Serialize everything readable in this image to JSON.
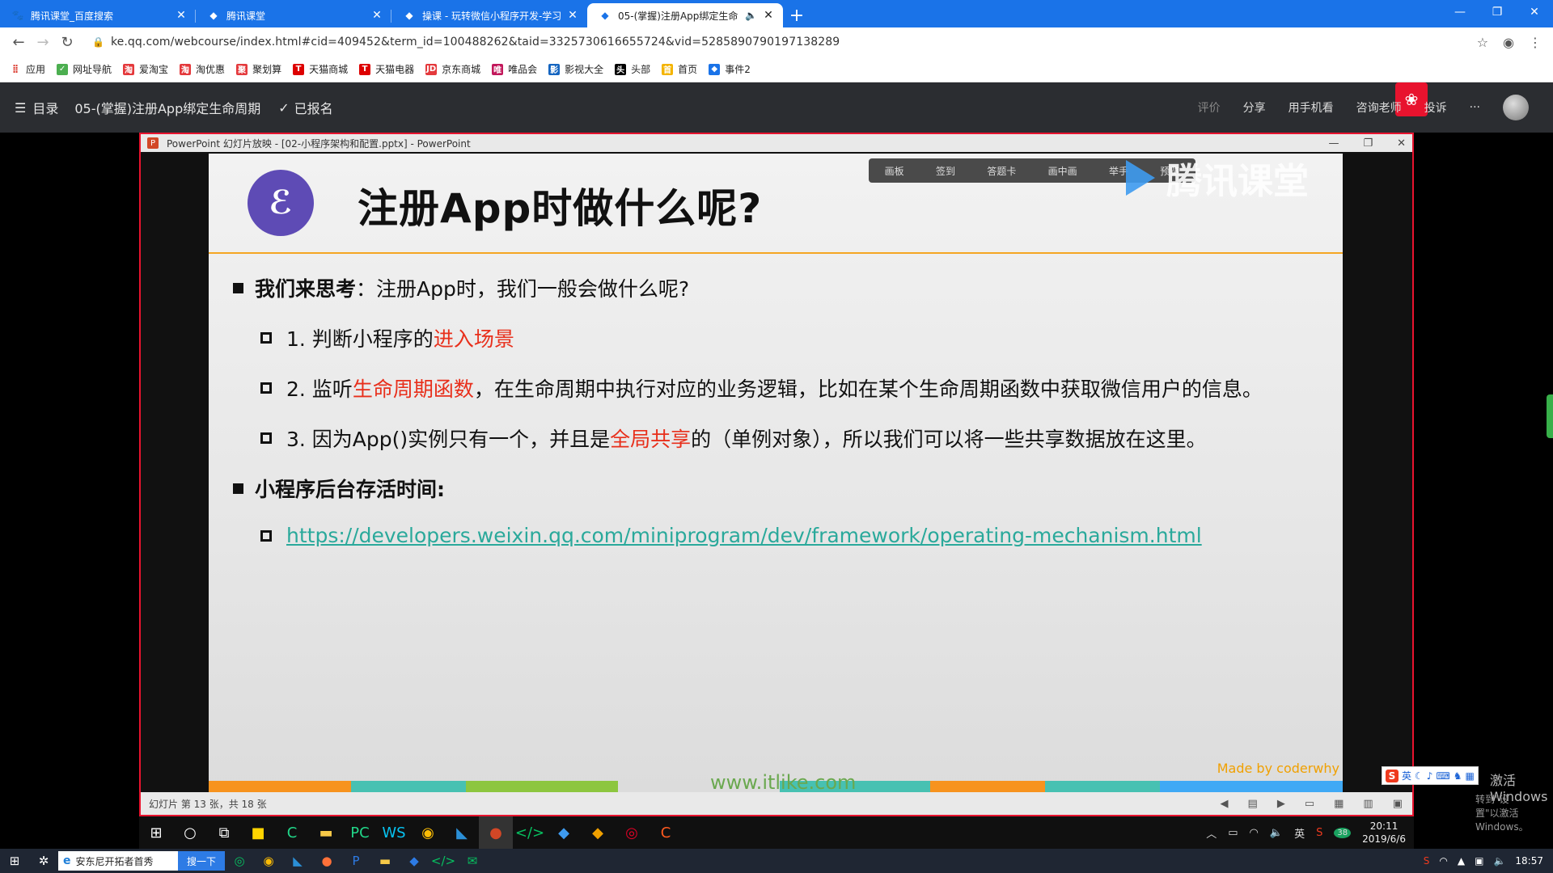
{
  "browser": {
    "tabs": [
      {
        "title": "腾讯课堂_百度搜索",
        "icon": "baidu-icon",
        "active": false
      },
      {
        "title": "腾讯课堂",
        "icon": "tencent-classroom-icon",
        "active": false
      },
      {
        "title": "操课 - 玩转微信小程序开发-学习",
        "icon": "tencent-classroom-icon",
        "active": false
      },
      {
        "title": "05-(掌握)注册App绑定生命",
        "icon": "tencent-classroom-icon",
        "active": true
      }
    ],
    "new_tab": "+",
    "url": "ke.qq.com/webcourse/index.html#cid=409452&term_id=100488262&taid=3325730616655724&vid=5285890790197138289",
    "bookmarks": [
      "应用",
      "网址导航",
      "爱淘宝",
      "淘优惠",
      "聚划算",
      "天猫商城",
      "天猫电器",
      "京东商城",
      "唯品会",
      "影视大全",
      "头部",
      "首页",
      "事件2"
    ]
  },
  "course_header": {
    "menu_label": "目录",
    "title": "05-(掌握)注册App绑定生命周期",
    "signed_label": "已报名",
    "right_items": [
      "评价",
      "分享",
      "用手机看",
      "咨询老师",
      "投诉",
      "···"
    ]
  },
  "ppt": {
    "window_title": "PowerPoint 幻灯片放映 - [02-小程序架构和配置.pptx] - PowerPoint",
    "status_text": "幻灯片 第 13 张，共 18 张",
    "overlay_toolbar": [
      "画板",
      "签到",
      "答题卡",
      "画中画",
      "举手",
      "预览"
    ],
    "watermark": "腾讯课堂",
    "slide": {
      "title": "注册App时做什么呢?",
      "q_label": "我们来思考",
      "q_text": "：注册App时，我们一般会做什么呢?",
      "item1_pre": "1. 判断小程序的",
      "item1_red": "进入场景",
      "item2_pre": "2. 监听",
      "item2_red": "生命周期函数",
      "item2_post": "，在生命周期中执行对应的业务逻辑，比如在某个生命周期函数中获取微信用户的信息。",
      "item3_pre": "3. 因为App()实例只有一个，并且是",
      "item3_red": "全局共享",
      "item3_post": "的（单例对象），所以我们可以将一些共享数据放在这里。",
      "bg_label": "小程序后台存活时间:",
      "link": "https://developers.weixin.qq.com/miniprogram/dev/framework/operating-mechanism.html",
      "site": "www.itlike.com",
      "madeby": "Made by coderwhy"
    },
    "ime_label": "英",
    "activate_text": "激活 Windows",
    "activate_sub": "转到\"设置\"以激活 Windows。"
  },
  "inner_taskbar": {
    "ime": "英",
    "badge": "38",
    "time": "20:11",
    "date": "2019/6/6"
  },
  "taskbar": {
    "search_text": "安东尼开拓者首秀",
    "search_button": "搜一下",
    "time": "18:57"
  },
  "colors": {
    "tab_blue": "#1a73e8",
    "course_bg": "#2b2d31",
    "accent_red": "#e82f1b",
    "link_teal": "#2aa99b",
    "mp_purple": "#5e4bb5"
  }
}
